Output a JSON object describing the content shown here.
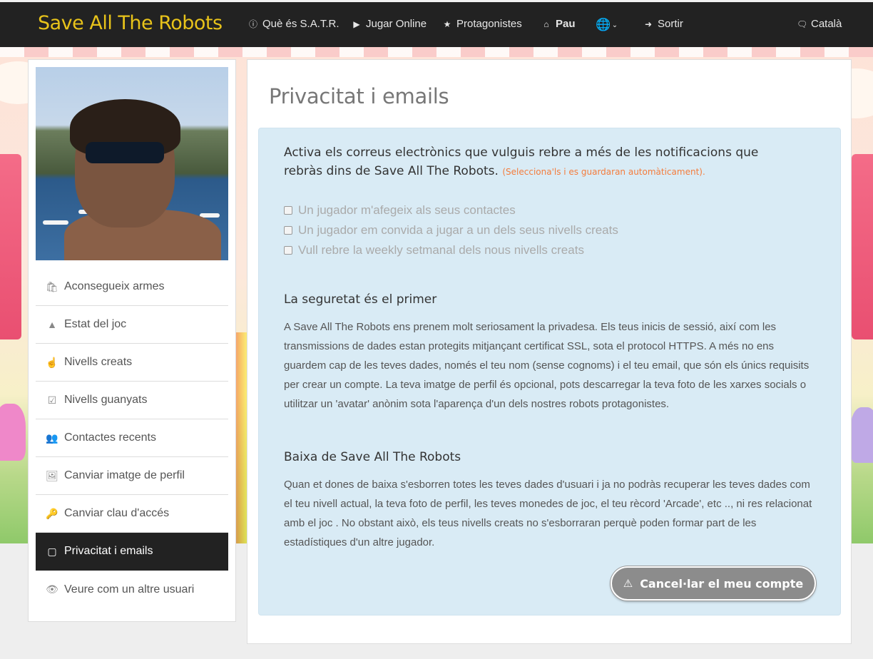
{
  "navbar": {
    "brand": "Save All The Robots",
    "items": [
      {
        "label": "Què és S.A.T.R.",
        "icon": "info-icon"
      },
      {
        "label": "Jugar Online",
        "icon": "play-icon"
      },
      {
        "label": "Protagonistes",
        "icon": "star-icon"
      },
      {
        "label": "Pau",
        "icon": "home-icon"
      },
      {
        "label": "",
        "icon": "globe-icon"
      },
      {
        "label": "Sortir",
        "icon": "sign-out-icon"
      }
    ],
    "language": {
      "label": "Català",
      "icon": "comments-icon"
    }
  },
  "sidebar": {
    "menu": [
      {
        "label": "Aconsegueix armes",
        "icon": "shopping-bag-icon"
      },
      {
        "label": "Estat del joc",
        "icon": "area-chart-icon"
      },
      {
        "label": "Nivells creats",
        "icon": "hand-pointer-icon"
      },
      {
        "label": "Nivells guanyats",
        "icon": "check-square-icon"
      },
      {
        "label": "Contactes recents",
        "icon": "users-icon"
      },
      {
        "label": "Canviar imatge de perfil",
        "icon": "picture-icon"
      },
      {
        "label": "Canviar clau d'accés",
        "icon": "key-icon"
      },
      {
        "label": "Privacitat i emails",
        "icon": "note-icon"
      },
      {
        "label": "Veure com un altre usuari",
        "icon": "eye-slash-icon"
      }
    ],
    "active_index": 7
  },
  "main": {
    "title": "Privacitat i emails",
    "intro": "Activa els correus electrònics que vulguis rebre a més de les notificacions que rebràs dins de Save All The Robots.",
    "intro_note": "(Selecciona'ls i es guardaran automàticament).",
    "checkboxes": [
      {
        "label": "Un jugador m'afegeix als seus contactes",
        "checked": false
      },
      {
        "label": "Un jugador em convida a jugar a un dels seus nivells creats",
        "checked": false
      },
      {
        "label": "Vull rebre la weekly setmanal dels nous nivells creats",
        "checked": false
      }
    ],
    "security_heading": "La seguretat és el primer",
    "security_text": "A Save All The Robots ens prenem molt seriosament la privadesa. Els teus inicis de sessió, així com les transmissions de dades estan protegits mitjançant certificat SSL, sota el protocol HTTPS. A més no ens guardem cap de les teves dades, només el teu nom (sense cognoms) i el teu email, que són els únics requisits per crear un compte. La teva imatge de perfil és opcional, pots descarregar la teva foto de les xarxes socials o utilitzar un 'avatar' anònim sota l'aparença d'un dels nostres robots protagonistes.",
    "cancel_heading": "Baixa de Save All The Robots",
    "cancel_text": "Quan et dones de baixa s'esborren totes les teves dades d'usuari i ja no podràs recuperar les teves dades com el teu nivell actual, la teva foto de perfil, les teves monedes de joc, el teu rècord 'Arcade', etc .., ni res relacionat amb el joc . No obstant això, els teus nivells creats no s'esborraran perquè poden formar part de les estadístiques d'un altre jugador.",
    "cancel_button": "Cancel·lar el meu compte"
  },
  "colors": {
    "navbar_bg": "#222222",
    "brand": "#e8c31a",
    "well_bg": "#d9ebf5",
    "note": "#f47c3c",
    "active_menu_bg": "#222222",
    "button_bg": "#8c8c8c"
  }
}
